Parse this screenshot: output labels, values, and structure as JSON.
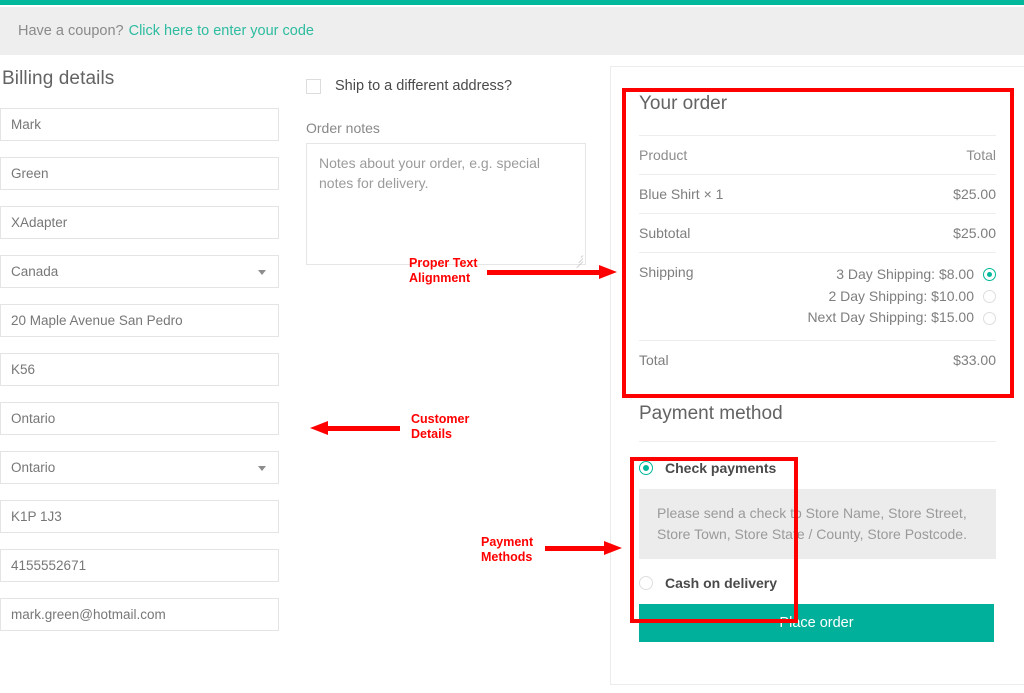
{
  "theme": {
    "accent": "#00b89c",
    "link": "#2dbca0",
    "annotation": "#ff0000",
    "panel_bg": "#ececec"
  },
  "coupon": {
    "text": "Have a coupon?",
    "link_label": "Click here to enter your code"
  },
  "billing": {
    "title": "Billing details",
    "fields": [
      {
        "name": "first-name",
        "value": "Mark",
        "type": "text"
      },
      {
        "name": "last-name",
        "value": "Green",
        "type": "text"
      },
      {
        "name": "company",
        "value": "XAdapter",
        "type": "text"
      },
      {
        "name": "country",
        "value": "Canada",
        "type": "select"
      },
      {
        "name": "address-1",
        "value": "20 Maple Avenue San Pedro",
        "type": "text"
      },
      {
        "name": "address-2",
        "value": "K56",
        "type": "text"
      },
      {
        "name": "city",
        "value": "Ontario",
        "type": "text"
      },
      {
        "name": "state",
        "value": "Ontario",
        "type": "select"
      },
      {
        "name": "postcode",
        "value": "K1P 1J3",
        "type": "text"
      },
      {
        "name": "phone",
        "value": "4155552671",
        "type": "text"
      },
      {
        "name": "email",
        "value": "mark.green@hotmail.com",
        "type": "text"
      }
    ]
  },
  "shipping_form": {
    "ship_different_label": "Ship to a different address?",
    "ship_different_checked": false,
    "order_notes_label": "Order notes",
    "order_notes_value": "",
    "order_notes_placeholder": "Notes about your order, e.g. special notes for delivery."
  },
  "order": {
    "title": "Your order",
    "columns": {
      "product": "Product",
      "total": "Total"
    },
    "items": [
      {
        "name": "Blue Shirt",
        "quantity": "× 1",
        "total": "$25.00"
      }
    ],
    "subtotal_label": "Subtotal",
    "subtotal_value": "$25.00",
    "shipping_label": "Shipping",
    "shipping_options": [
      {
        "label": "3 Day Shipping: $8.00",
        "selected": true
      },
      {
        "label": "2 Day Shipping: $10.00",
        "selected": false
      },
      {
        "label": "Next Day Shipping: $15.00",
        "selected": false
      }
    ],
    "total_label": "Total",
    "total_value": "$33.00"
  },
  "payment": {
    "title": "Payment method",
    "methods": [
      {
        "label": "Check payments",
        "selected": true
      },
      {
        "label": "Cash on delivery",
        "selected": false
      }
    ],
    "check_description": "Please send a check to Store Name, Store Street, Store Town, Store State / County, Store Postcode.",
    "place_order_label": "Place order"
  },
  "annotations": [
    {
      "name": "proper-text-alignment",
      "label": "Proper Text\nAlignment"
    },
    {
      "name": "customer-details",
      "label": "Customer\nDetails"
    },
    {
      "name": "payment-methods",
      "label": "Payment\nMethods"
    }
  ]
}
